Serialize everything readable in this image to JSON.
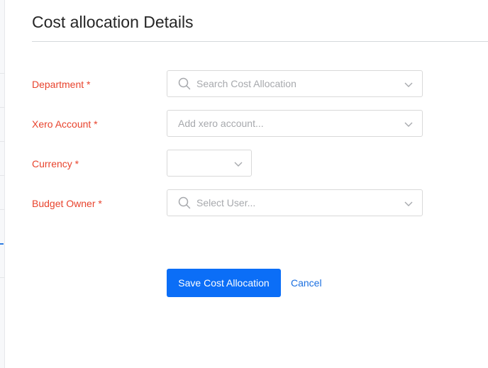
{
  "page": {
    "title": "Cost allocation Details"
  },
  "form": {
    "fields": [
      {
        "label": "Department *",
        "placeholder": "Search Cost Allocation",
        "value": "",
        "icon": "search-icon"
      },
      {
        "label": "Xero Account *",
        "placeholder": "Add xero account...",
        "value": ""
      },
      {
        "label": "Currency *",
        "placeholder": "",
        "value": ""
      },
      {
        "label": "Budget Owner *",
        "placeholder": "Select User...",
        "value": "",
        "icon": "search-icon"
      }
    ],
    "save_label": "Save Cost Allocation",
    "cancel_label": "Cancel"
  },
  "colors": {
    "label_required": "#e8432d",
    "primary": "#0b6ef7",
    "link": "#1a6fe0"
  }
}
